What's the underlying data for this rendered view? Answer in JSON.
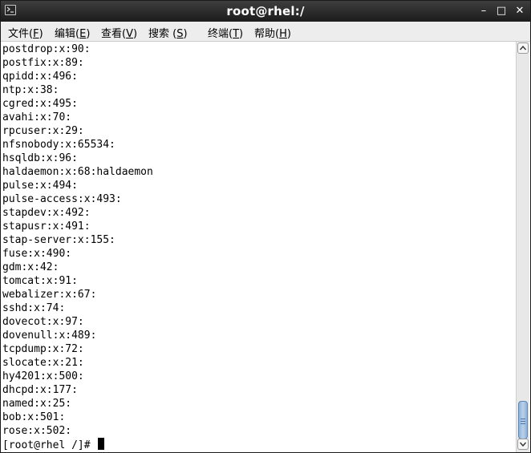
{
  "window": {
    "title": "root@rhel:/",
    "controls": {
      "minimize": "–",
      "maximize": "□",
      "close": "✕"
    }
  },
  "menu": [
    {
      "label": "文件",
      "mnemonic_open": "(",
      "mnemonic": "F",
      "mnemonic_close": ")"
    },
    {
      "label": "编辑",
      "mnemonic_open": "(",
      "mnemonic": "E",
      "mnemonic_close": ")"
    },
    {
      "label": "查看",
      "mnemonic_open": "(",
      "mnemonic": "V",
      "mnemonic_close": ")"
    },
    {
      "label": "搜索",
      "mnemonic_open": " (",
      "mnemonic": "S",
      "mnemonic_close": ")"
    },
    {
      "label": "终端",
      "mnemonic_open": "(",
      "mnemonic": "T",
      "mnemonic_close": ")"
    },
    {
      "label": "帮助",
      "mnemonic_open": "(",
      "mnemonic": "H",
      "mnemonic_close": ")"
    }
  ],
  "terminal": {
    "lines": [
      "postdrop:x:90:",
      "postfix:x:89:",
      "qpidd:x:496:",
      "ntp:x:38:",
      "cgred:x:495:",
      "avahi:x:70:",
      "rpcuser:x:29:",
      "nfsnobody:x:65534:",
      "hsqldb:x:96:",
      "haldaemon:x:68:haldaemon",
      "pulse:x:494:",
      "pulse-access:x:493:",
      "stapdev:x:492:",
      "stapusr:x:491:",
      "stap-server:x:155:",
      "fuse:x:490:",
      "gdm:x:42:",
      "tomcat:x:91:",
      "webalizer:x:67:",
      "sshd:x:74:",
      "dovecot:x:97:",
      "dovenull:x:489:",
      "tcpdump:x:72:",
      "slocate:x:21:",
      "hy4201:x:500:",
      "dhcpd:x:177:",
      "named:x:25:",
      "bob:x:501:",
      "rose:x:502:"
    ],
    "prompt": "[root@rhel /]# "
  },
  "scrollbar": {
    "position_fraction": 1.0,
    "visible_fraction": 0.1
  },
  "colors": {
    "titlebar": "#2b2b2b",
    "menubar": "#ededed",
    "terminal_bg": "#ffffff",
    "terminal_fg": "#000000",
    "scroll_thumb": "#a8c4e4"
  },
  "icons": {
    "app": "terminal-icon",
    "scroll_up": "arrow-up-icon",
    "scroll_down": "arrow-down-icon"
  }
}
